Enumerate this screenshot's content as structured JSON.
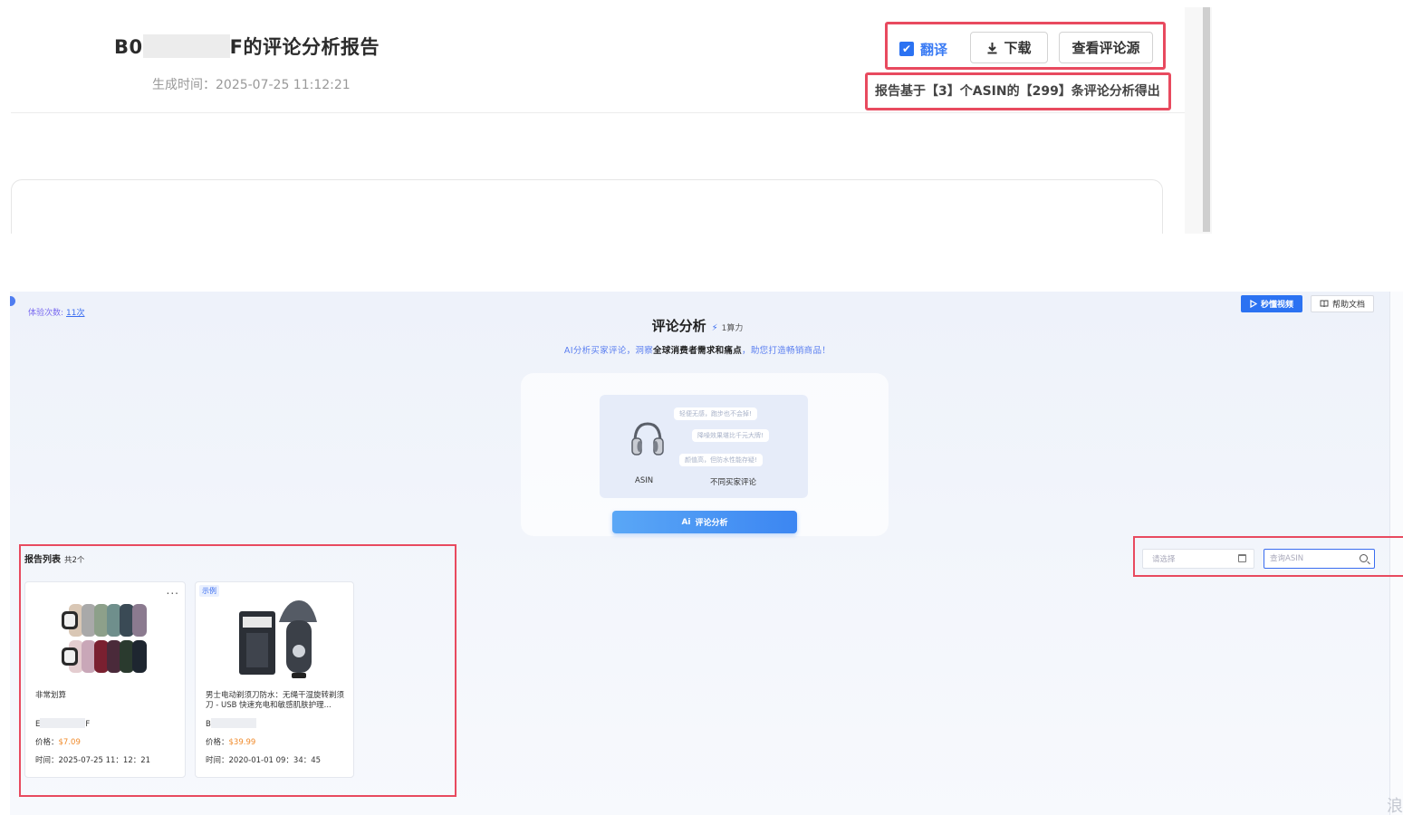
{
  "report_header": {
    "title_prefix": "B0",
    "title_suffix": "F的评论分析报告",
    "generated_label": "生成时间：",
    "generated_value": "2025-07-25 11:12:21",
    "translate_label": "翻译",
    "translate_checked": true,
    "download_label": "下载",
    "view_source_label": "查看评论源",
    "basis_text": "报告基于【3】个ASIN的【299】条评论分析得出"
  },
  "app": {
    "trial_label": "体验次数:",
    "trial_count": "11次",
    "video_button": "秒懂视频",
    "help_button": "帮助文档",
    "title": "评论分析",
    "cost": "1算力",
    "subtitle_prefix": "AI分析买家评论，洞察",
    "subtitle_bold": "全球消费者需求和痛点",
    "subtitle_suffix": "，助您打造畅销商品！",
    "intro": {
      "asin_label": "ASIN",
      "reviews_label": "不同买家评论",
      "bubbles": [
        "轻便无感，跑步也不会掉!",
        "降噪效果堪比千元大牌!",
        "颜值高，但防水性能存疑!"
      ]
    },
    "analyze_button": "评论分析",
    "analyze_prefix": "Ai"
  },
  "report_list": {
    "title": "报告列表",
    "total": "共2个",
    "cards": [
      {
        "name": "非常划算",
        "asin_prefix": "E",
        "asin_suffix": "F",
        "price_label": "价格：",
        "price": "$7.09",
        "time_label": "时间：",
        "time": "2025-07-25 11：12：21",
        "badge": "",
        "more": "..."
      },
      {
        "name": "男士电动剃须刀防水：无绳干湿旋转剃须刀 - USB 快速充电和敏感肌肤护理...",
        "asin_prefix": "B",
        "asin_suffix": "",
        "price_label": "价格：",
        "price": "$39.99",
        "time_label": "时间：",
        "time": "2020-01-01 09：34：45",
        "badge": "示例",
        "more": ""
      }
    ]
  },
  "filters": {
    "select_placeholder": "请选择",
    "search_placeholder": "查询ASIN"
  },
  "colors": {
    "highlight": "#e84a5f",
    "accent": "#2b72f2",
    "price": "#f08a2a"
  },
  "icons": [
    "check-icon",
    "download-icon",
    "play-icon",
    "book-icon",
    "bolt-icon",
    "headphone-icon",
    "calendar-icon",
    "search-icon"
  ]
}
